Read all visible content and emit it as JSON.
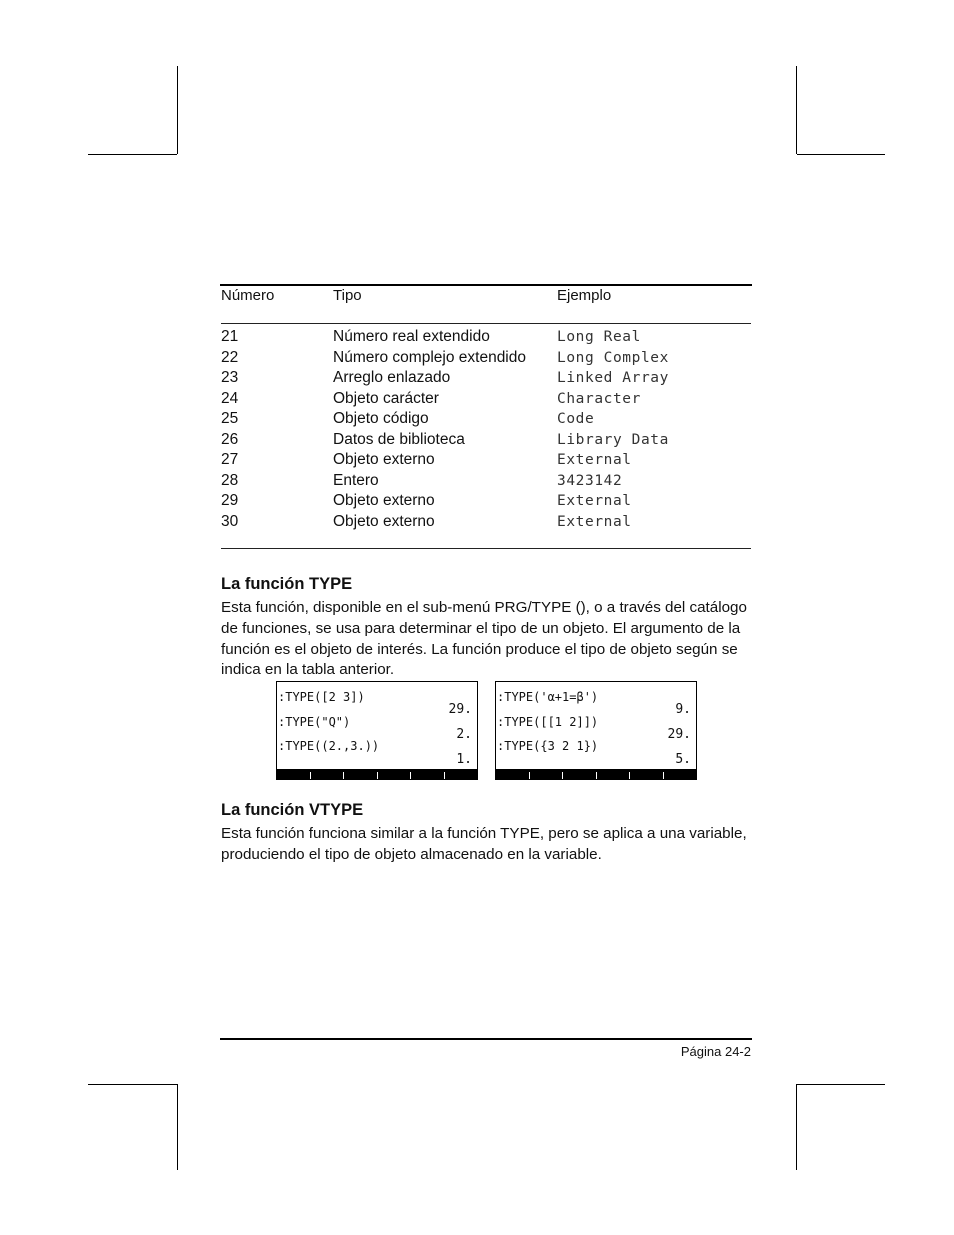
{
  "table": {
    "headers": [
      "Número",
      "Tipo",
      "Ejemplo"
    ],
    "rows": [
      {
        "num": "21",
        "tipo": "Número real extendido",
        "ejemplo": "Long Real"
      },
      {
        "num": "22",
        "tipo": "Número complejo extendido",
        "ejemplo": "Long Complex"
      },
      {
        "num": "23",
        "tipo": "Arreglo enlazado",
        "ejemplo": "Linked Array"
      },
      {
        "num": "24",
        "tipo": "Objeto carácter",
        "ejemplo": "Character"
      },
      {
        "num": "25",
        "tipo": "Objeto código",
        "ejemplo": "Code"
      },
      {
        "num": "26",
        "tipo": "Datos de biblioteca",
        "ejemplo": "Library Data"
      },
      {
        "num": "27",
        "tipo": "Objeto externo",
        "ejemplo": "External"
      },
      {
        "num": "28",
        "tipo": "Entero",
        "ejemplo": "3423142"
      },
      {
        "num": "29",
        "tipo": "Objeto externo",
        "ejemplo": "External"
      },
      {
        "num": "30",
        "tipo": "Objeto externo",
        "ejemplo": "External"
      }
    ]
  },
  "sections": [
    {
      "heading": "La función TYPE",
      "paragraph": "Esta función, disponible en el sub-menú PRG/TYPE (), o a través del catálogo de funciones, se usa para determinar el tipo de un objeto.  El argumento de la función es el objeto de interés.   La función produce el tipo de objeto según se indica en la tabla anterior."
    },
    {
      "heading": "La función VTYPE",
      "paragraph": "Esta función funciona similar a la función TYPE, pero se aplica a una variable, produciendo el tipo de objeto almacenado en la variable."
    }
  ],
  "calc_screens": [
    {
      "entries": [
        {
          "cmd": ":TYPE([2 3])",
          "result": "29."
        },
        {
          "cmd": ":TYPE(\"Q\")",
          "result": "2."
        },
        {
          "cmd": ":TYPE((2.,3.))",
          "result": "1."
        }
      ]
    },
    {
      "entries": [
        {
          "cmd": ":TYPE('α+1=β')",
          "result": "9."
        },
        {
          "cmd": ":TYPE([[1 2]])",
          "result": "29."
        },
        {
          "cmd": ":TYPE({3 2 1})",
          "result": "5."
        }
      ]
    }
  ],
  "footer": {
    "page_label": "Página 24-2"
  }
}
